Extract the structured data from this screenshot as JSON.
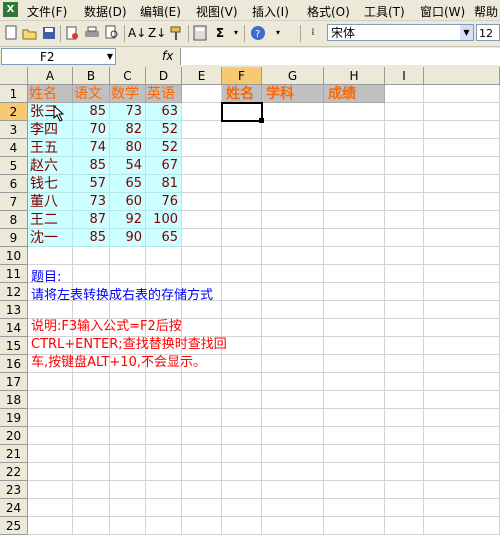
{
  "menu": {
    "items": [
      "文件(F)",
      "数据(D)",
      "编辑(E)",
      "视图(V)",
      "插入(I)",
      "格式(O)",
      "工具(T)",
      "窗口(W)",
      "帮助"
    ]
  },
  "toolbar": {
    "font_name": "宋体",
    "font_size": "12",
    "icons": [
      "new-icon",
      "open-icon",
      "save-icon",
      "permission-icon",
      "print-icon",
      "print-preview-icon",
      "sort-ascending-icon",
      "sort-descending-icon",
      "format-painter-icon",
      "calculator-icon",
      "sum-icon",
      "help-icon"
    ]
  },
  "formula_bar": {
    "name_box": "F2",
    "fx": "fx",
    "formula": ""
  },
  "grid": {
    "columns": [
      "A",
      "B",
      "C",
      "D",
      "E",
      "F",
      "G",
      "H",
      "I"
    ],
    "selected_column": "F",
    "selected_row": "2",
    "rows": [
      "1",
      "2",
      "3",
      "4",
      "5",
      "6",
      "7",
      "8",
      "9",
      "10",
      "11",
      "12",
      "13",
      "14",
      "15",
      "16",
      "17",
      "18",
      "19",
      "20",
      "21",
      "22",
      "23",
      "24",
      "25"
    ]
  },
  "left_table": {
    "headers": [
      "姓名",
      "语文",
      "数学",
      "英语"
    ],
    "rows": [
      [
        "张三",
        "85",
        "73",
        "63"
      ],
      [
        "李四",
        "70",
        "82",
        "52"
      ],
      [
        "王五",
        "74",
        "80",
        "52"
      ],
      [
        "赵六",
        "85",
        "54",
        "67"
      ],
      [
        "钱七",
        "57",
        "65",
        "81"
      ],
      [
        "董八",
        "73",
        "60",
        "76"
      ],
      [
        "王二",
        "87",
        "92",
        "100"
      ],
      [
        "沈一",
        "85",
        "90",
        "65"
      ]
    ]
  },
  "right_table": {
    "headers": [
      "姓名",
      "学科",
      "成绩"
    ]
  },
  "notes": {
    "title": "题目:",
    "task": "请将左表转换成右表的存储方式",
    "explain_line1": "说明:F3输入公式=F2后按",
    "explain_line2": "CTRL+ENTER;查找替换时查找回",
    "explain_line3": "车,按键盘ALT+10,不会显示。"
  },
  "colors": {
    "header_orange": "#ff6600",
    "data_maroon": "#800000",
    "cyan_fill": "#ccffff",
    "gray_fill": "#c0c0c0",
    "selected_header": "#f8c972",
    "note_blue": "#0000ff",
    "note_red": "#ff0000"
  }
}
